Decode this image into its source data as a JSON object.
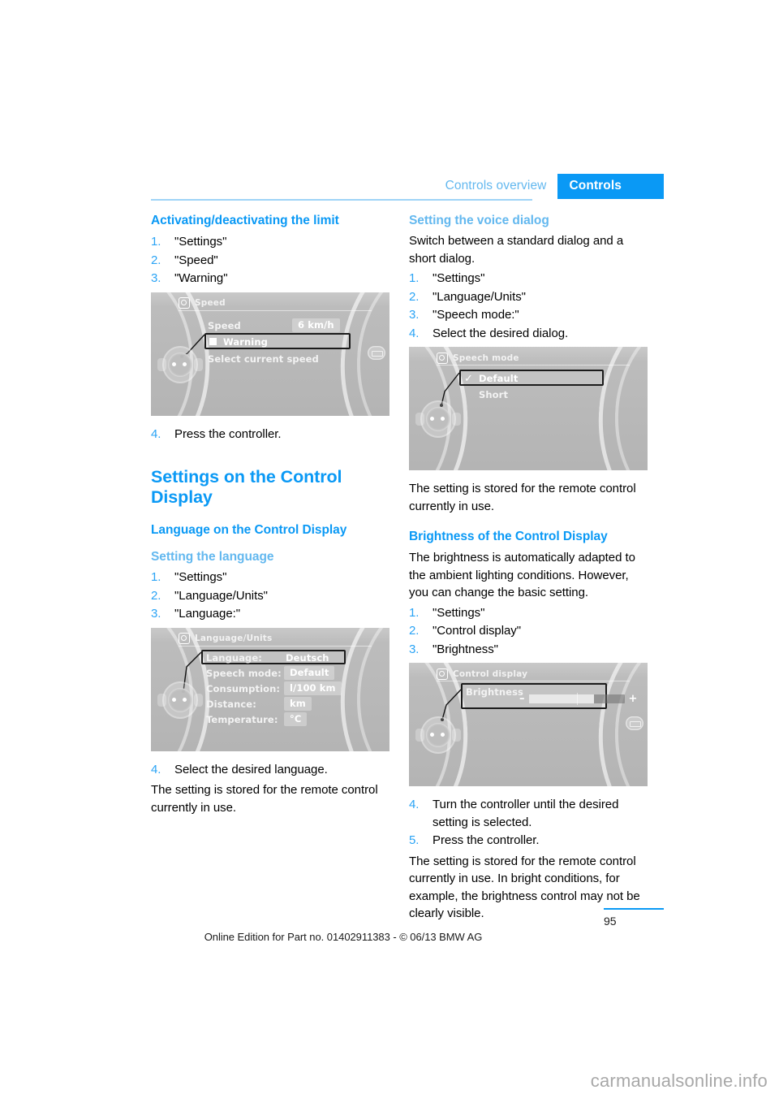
{
  "header": {
    "tab_inactive": "Controls overview",
    "tab_active": "Controls",
    "accent_color": "#0a99f5",
    "accent_light": "#63b8ef"
  },
  "left_column": {
    "heading_limit": "Activating/deactivating the limit",
    "steps_limit": [
      {
        "num": "1.",
        "text": "\"Settings\""
      },
      {
        "num": "2.",
        "text": "\"Speed\""
      },
      {
        "num": "3.",
        "text": "\"Warning\""
      }
    ],
    "figure_speed": {
      "title": "Speed",
      "row_label": "Speed",
      "row_value": "6 km/h",
      "highlight_item": "Warning",
      "hint": "Select current speed"
    },
    "step_after_speed": {
      "num": "4.",
      "text": "Press the controller."
    },
    "heading_settings": "Settings on the Control Display",
    "heading_language": "Language on the Control Display",
    "heading_setting_language": "Setting the language",
    "steps_language": [
      {
        "num": "1.",
        "text": "\"Settings\""
      },
      {
        "num": "2.",
        "text": "\"Language/Units\""
      },
      {
        "num": "3.",
        "text": "\"Language:\""
      }
    ],
    "figure_language": {
      "title": "Language/Units",
      "rows": [
        {
          "label": "Language:",
          "value": "Deutsch",
          "highlighted": true
        },
        {
          "label": "Speech mode:",
          "value": "Default",
          "highlighted": false
        },
        {
          "label": "Consumption:",
          "value": "l/100 km",
          "highlighted": false
        },
        {
          "label": "Distance:",
          "value": "km",
          "highlighted": false
        },
        {
          "label": "Temperature:",
          "value": "°C",
          "highlighted": false
        }
      ]
    },
    "step_select_language": {
      "num": "4.",
      "text": "Select the desired language."
    },
    "stored_note": "The setting is stored for the remote control currently in use."
  },
  "right_column": {
    "heading_voice": "Setting the voice dialog",
    "intro_voice": "Switch between a standard dialog and a short dialog.",
    "steps_voice": [
      {
        "num": "1.",
        "text": "\"Settings\""
      },
      {
        "num": "2.",
        "text": "\"Language/Units\""
      },
      {
        "num": "3.",
        "text": "\"Speech mode:\""
      },
      {
        "num": "4.",
        "text": "Select the desired dialog."
      }
    ],
    "figure_speech": {
      "title": "Speech mode",
      "option_selected": "Default",
      "option_other": "Short"
    },
    "stored_note": "The setting is stored for the remote control currently in use.",
    "heading_brightness": "Brightness of the Control Display",
    "intro_brightness": "The brightness is automatically adapted to the ambient lighting conditions. However, you can change the basic setting.",
    "steps_brightness": [
      {
        "num": "1.",
        "text": "\"Settings\""
      },
      {
        "num": "2.",
        "text": "\"Control display\""
      },
      {
        "num": "3.",
        "text": "\"Brightness\""
      }
    ],
    "figure_control_display": {
      "title": "Control display",
      "row_label": "Brightness",
      "minus": "–",
      "plus": "+"
    },
    "steps_brightness_after": [
      {
        "num": "4.",
        "text": "Turn the controller until the desired setting is selected."
      },
      {
        "num": "5.",
        "text": "Press the controller."
      }
    ],
    "closing_note": "The setting is stored for the remote control currently in use. In bright conditions, for example, the brightness control may not be clearly visible."
  },
  "footer": {
    "edition_line": "Online Edition for Part no. 01402911383 - © 06/13 BMW AG",
    "page_number": "95",
    "watermark": "carmanualsonline.info"
  }
}
